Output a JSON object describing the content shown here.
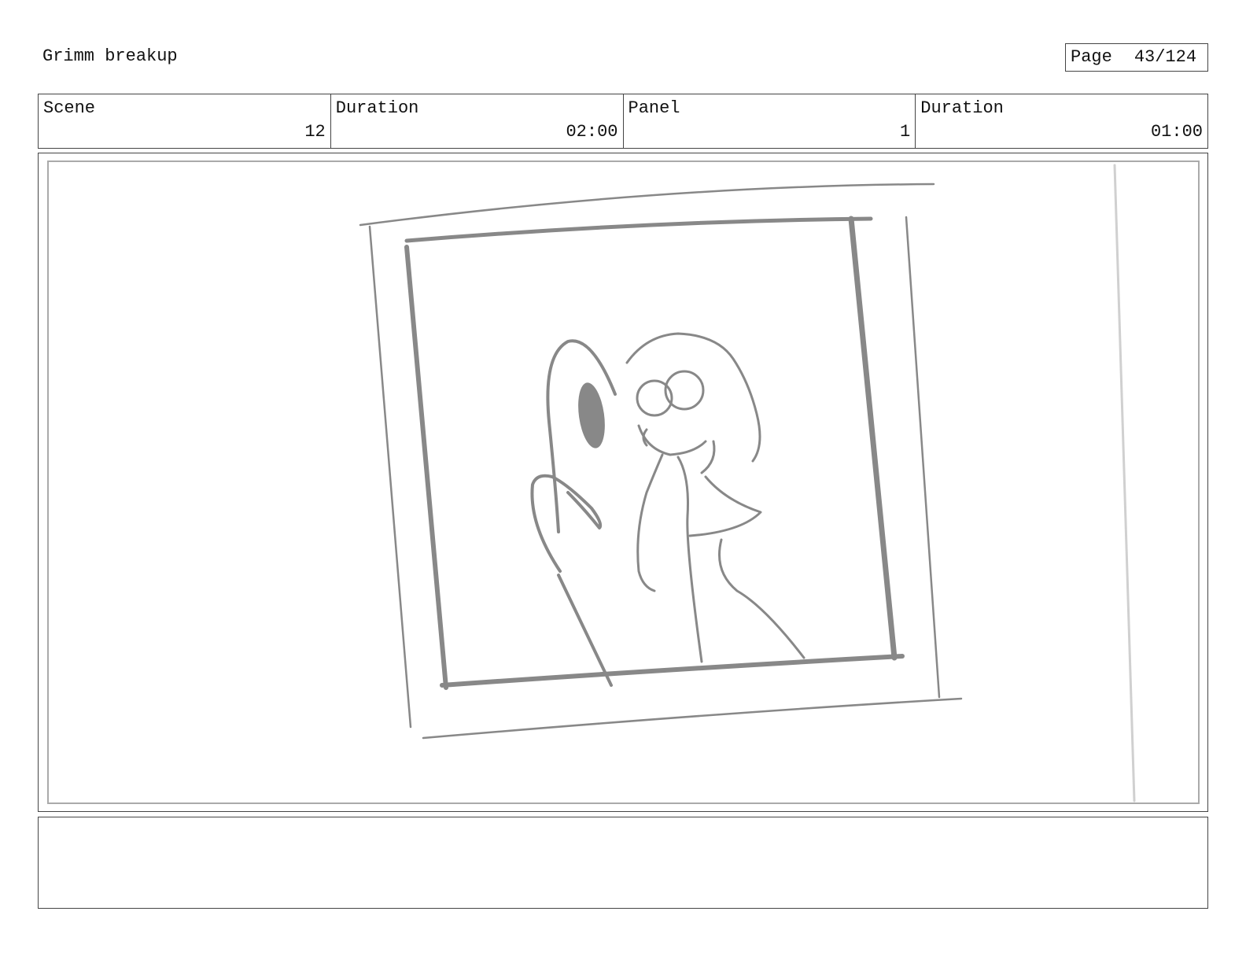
{
  "header": {
    "title": "Grimm breakup",
    "page_label": "Page",
    "page_number": "43/124"
  },
  "info": {
    "scene_label": "Scene",
    "scene_value": "12",
    "scene_duration_label": "Duration",
    "scene_duration_value": "02:00",
    "panel_label": "Panel",
    "panel_value": "1",
    "panel_duration_label": "Duration",
    "panel_duration_value": "01:00"
  },
  "notes": {
    "text": ""
  },
  "colors": {
    "sketch_stroke": "#888888",
    "frame_border": "#aaaaaa"
  }
}
